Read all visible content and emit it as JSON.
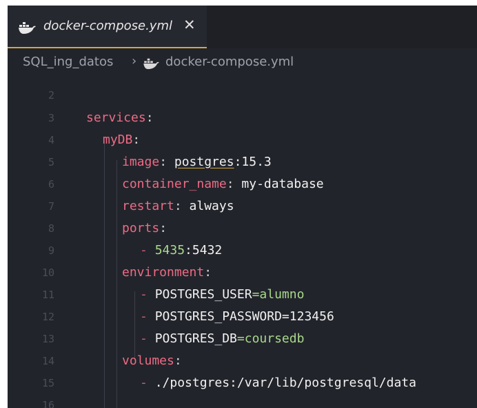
{
  "tab": {
    "filename": "docker-compose.yml",
    "close_glyph": "✕",
    "icon": "docker-icon"
  },
  "breadcrumb": {
    "folder": "SQL_ing_datos",
    "separator": "›",
    "file": "docker-compose.yml"
  },
  "editor": {
    "line_numbers": [
      "2",
      "3",
      "4",
      "5",
      "6",
      "7",
      "8",
      "9",
      "10",
      "11",
      "12",
      "13",
      "14",
      "15",
      "16"
    ],
    "code": {
      "services_key": "services",
      "service_name": "myDB",
      "image_key": "image",
      "image_name": "postgres",
      "image_tag": "15.3",
      "container_name_key": "container_name",
      "container_name_value": "my-database",
      "restart_key": "restart",
      "restart_value": "always",
      "ports_key": "ports",
      "port_host": "5435",
      "port_container": "5432",
      "environment_key": "environment",
      "env_user_var": "POSTGRES_USER",
      "env_user_value": "alumno",
      "env_password_var": "POSTGRES_PASSWORD",
      "env_password_value": "123456",
      "env_db_var": "POSTGRES_DB",
      "env_db_value": "coursedb",
      "volumes_key": "volumes",
      "volume_mapping": "./postgres:/var/lib/postgresql/data"
    }
  },
  "colors": {
    "editor_bg": "#22242b",
    "tab_accent": "#d6a742",
    "yaml_key": "#ee6b84",
    "string_value": "#a9d98c",
    "plain_value": "#f2f2f2",
    "line_number": "#4a4e58"
  }
}
